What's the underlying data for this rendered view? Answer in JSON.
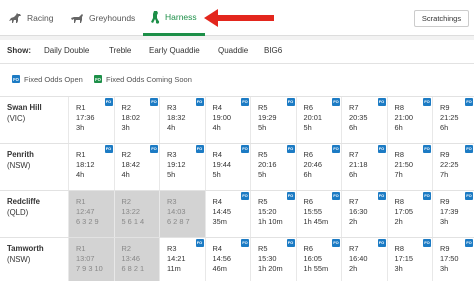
{
  "nav": {
    "tabs": [
      {
        "label": "Racing",
        "icon": "horse-icon"
      },
      {
        "label": "Greyhounds",
        "icon": "greyhound-icon"
      },
      {
        "label": "Harness",
        "icon": "harness-icon",
        "active": true
      }
    ],
    "scratchings_label": "Scratchings",
    "accent_color": "#1d8f48",
    "arrow_color": "#e3261d"
  },
  "filters": {
    "show_label": "Show:",
    "items": [
      "Daily Double",
      "Treble",
      "Early Quaddie",
      "Quaddie",
      "BIG6"
    ]
  },
  "legend": [
    {
      "badge": "FO",
      "color": "#1c7bc4",
      "label": "Fixed Odds Open"
    },
    {
      "badge": "FO",
      "color": "#1d8f48",
      "label": "Fixed Odds Coming Soon"
    }
  ],
  "meetings": [
    {
      "name": "Swan Hill",
      "state": "(VIC)",
      "races": [
        {
          "race": "R1",
          "line2": "17:36",
          "line3": "3h",
          "fo": "FO",
          "closed": false
        },
        {
          "race": "R2",
          "line2": "18:02",
          "line3": "3h",
          "fo": "FO",
          "closed": false
        },
        {
          "race": "R3",
          "line2": "18:32",
          "line3": "4h",
          "fo": "FO",
          "closed": false
        },
        {
          "race": "R4",
          "line2": "19:00",
          "line3": "4h",
          "fo": "FO",
          "closed": false
        },
        {
          "race": "R5",
          "line2": "19:29",
          "line3": "5h",
          "fo": "FO",
          "closed": false
        },
        {
          "race": "R6",
          "line2": "20:01",
          "line3": "5h",
          "fo": "FO",
          "closed": false
        },
        {
          "race": "R7",
          "line2": "20:35",
          "line3": "6h",
          "fo": "FO",
          "closed": false
        },
        {
          "race": "R8",
          "line2": "21:00",
          "line3": "6h",
          "fo": "FO",
          "closed": false
        },
        {
          "race": "R9",
          "line2": "21:25",
          "line3": "6h",
          "fo": "FO",
          "closed": false
        }
      ]
    },
    {
      "name": "Penrith",
      "state": "(NSW)",
      "races": [
        {
          "race": "R1",
          "line2": "18:12",
          "line3": "4h",
          "fo": "FO",
          "closed": false
        },
        {
          "race": "R2",
          "line2": "18:42",
          "line3": "4h",
          "fo": "FO",
          "closed": false
        },
        {
          "race": "R3",
          "line2": "19:12",
          "line3": "5h",
          "fo": "FO",
          "closed": false
        },
        {
          "race": "R4",
          "line2": "19:44",
          "line3": "5h",
          "fo": "FO",
          "closed": false
        },
        {
          "race": "R5",
          "line2": "20:16",
          "line3": "5h",
          "fo": "FO",
          "closed": false
        },
        {
          "race": "R6",
          "line2": "20:46",
          "line3": "6h",
          "fo": "FO",
          "closed": false
        },
        {
          "race": "R7",
          "line2": "21:18",
          "line3": "6h",
          "fo": "FO",
          "closed": false
        },
        {
          "race": "R8",
          "line2": "21:50",
          "line3": "7h",
          "fo": "FO",
          "closed": false
        },
        {
          "race": "R9",
          "line2": "22:25",
          "line3": "7h",
          "fo": "FO",
          "closed": false
        }
      ]
    },
    {
      "name": "Redcliffe",
      "state": "(QLD)",
      "races": [
        {
          "race": "R1",
          "line2": "12:47",
          "line3": "6 3 2 9",
          "fo": "",
          "closed": true
        },
        {
          "race": "R2",
          "line2": "13:22",
          "line3": "5 6 1 4",
          "fo": "",
          "closed": true
        },
        {
          "race": "R3",
          "line2": "14:03",
          "line3": "6 2 8 7",
          "fo": "",
          "closed": true
        },
        {
          "race": "R4",
          "line2": "14:45",
          "line3": "35m",
          "fo": "FO",
          "closed": false
        },
        {
          "race": "R5",
          "line2": "15:20",
          "line3": "1h 10m",
          "fo": "FO",
          "closed": false
        },
        {
          "race": "R6",
          "line2": "15:55",
          "line3": "1h 45m",
          "fo": "FO",
          "closed": false
        },
        {
          "race": "R7",
          "line2": "16:30",
          "line3": "2h",
          "fo": "FO",
          "closed": false
        },
        {
          "race": "R8",
          "line2": "17:05",
          "line3": "2h",
          "fo": "FO",
          "closed": false
        },
        {
          "race": "R9",
          "line2": "17:39",
          "line3": "3h",
          "fo": "FO",
          "closed": false
        }
      ]
    },
    {
      "name": "Tamworth",
      "state": "(NSW)",
      "races": [
        {
          "race": "R1",
          "line2": "13:07",
          "line3": "7 9 3 10",
          "fo": "",
          "closed": true
        },
        {
          "race": "R2",
          "line2": "13:46",
          "line3": "6 8 2 1",
          "fo": "",
          "closed": true
        },
        {
          "race": "R3",
          "line2": "14:21",
          "line3": "11m",
          "fo": "FO",
          "closed": false
        },
        {
          "race": "R4",
          "line2": "14:56",
          "line3": "46m",
          "fo": "FO",
          "closed": false
        },
        {
          "race": "R5",
          "line2": "15:30",
          "line3": "1h 20m",
          "fo": "FO",
          "closed": false
        },
        {
          "race": "R6",
          "line2": "16:05",
          "line3": "1h 55m",
          "fo": "FO",
          "closed": false
        },
        {
          "race": "R7",
          "line2": "16:40",
          "line3": "2h",
          "fo": "FO",
          "closed": false
        },
        {
          "race": "R8",
          "line2": "17:15",
          "line3": "3h",
          "fo": "FO",
          "closed": false
        },
        {
          "race": "R9",
          "line2": "17:50",
          "line3": "3h",
          "fo": "FO",
          "closed": false
        }
      ]
    }
  ]
}
